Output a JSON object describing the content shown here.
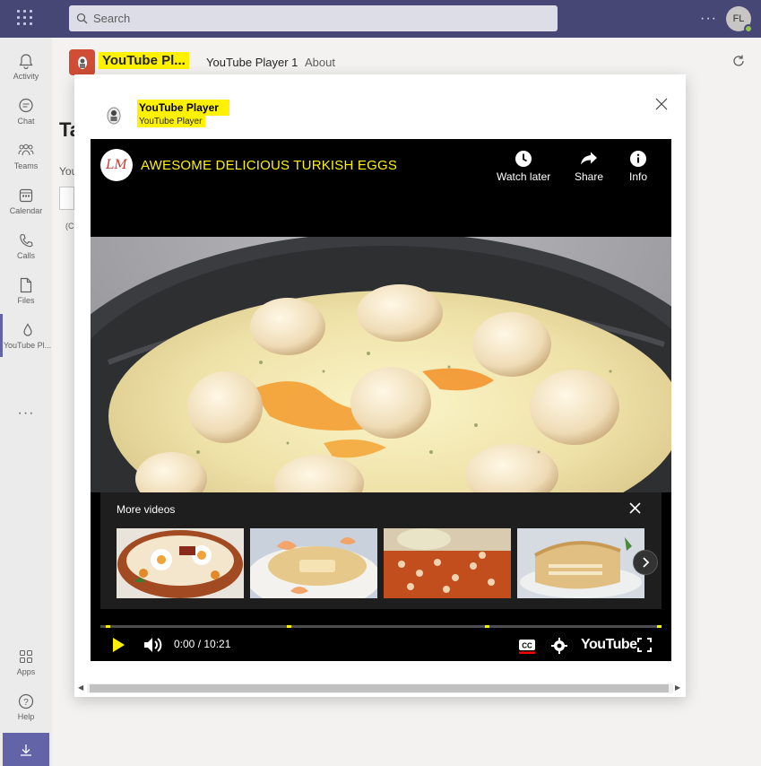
{
  "topbar": {
    "search_placeholder": "Search",
    "more_label": "···",
    "avatar_initials": "FL"
  },
  "rail": {
    "items": [
      {
        "label": "Activity",
        "icon": "bell-icon"
      },
      {
        "label": "Chat",
        "icon": "chat-icon"
      },
      {
        "label": "Teams",
        "icon": "teams-icon"
      },
      {
        "label": "Calendar",
        "icon": "calendar-icon"
      },
      {
        "label": "Calls",
        "icon": "phone-icon"
      },
      {
        "label": "Files",
        "icon": "file-icon"
      },
      {
        "label": "YouTube Pl...",
        "icon": "drop-icon"
      }
    ],
    "more": "···",
    "bottom": [
      {
        "label": "Apps",
        "icon": "apps-icon"
      },
      {
        "label": "Help",
        "icon": "help-icon"
      }
    ]
  },
  "app_header": {
    "app_name": "YouTube Pl...",
    "tab_player": "YouTube Player 1",
    "tab_about": "About"
  },
  "background": {
    "heading_frag": "Ta",
    "label_frag": "You",
    "small_frag": "(C"
  },
  "dialog": {
    "title": "YouTube Player",
    "subtitle": "YouTube Player",
    "close": "×"
  },
  "player": {
    "channel_logo": "LM",
    "video_title": "AWESOME DELICIOUS TURKISH EGGS",
    "actions": [
      {
        "label": "Watch later",
        "icon": "clock-icon"
      },
      {
        "label": "Share",
        "icon": "share-icon"
      },
      {
        "label": "Info",
        "icon": "info-icon"
      }
    ],
    "more_videos_label": "More videos",
    "time": "0:00 / 10:21",
    "youtube_logo": "YouTube",
    "cc_label": "CC",
    "thumbnails": [
      {
        "name": "thumb-eggs-bowl",
        "colors": [
          "#b5532a",
          "#f3e7d2",
          "#e0a44a"
        ]
      },
      {
        "name": "thumb-shrimp-plate",
        "colors": [
          "#e8d9b3",
          "#d4a15c",
          "#c8b49b"
        ]
      },
      {
        "name": "thumb-beans-tray",
        "colors": [
          "#c95a28",
          "#e6d6b8",
          "#8a3a1c"
        ]
      },
      {
        "name": "thumb-cake",
        "colors": [
          "#e7c990",
          "#c79a59",
          "#ddd2bd"
        ]
      }
    ]
  },
  "colors": {
    "teams_purple": "#464775",
    "highlight_yellow": "#fff200",
    "yt_red": "#ff0000"
  }
}
